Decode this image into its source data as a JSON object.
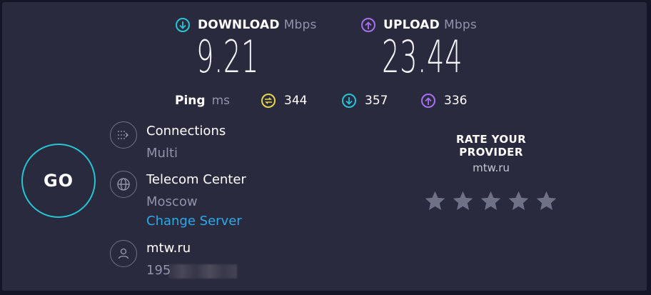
{
  "download": {
    "label": "DOWNLOAD",
    "unit": "Mbps",
    "value": "9.21",
    "icon": "download-arrow-icon",
    "color": "#26c5d3"
  },
  "upload": {
    "label": "UPLOAD",
    "unit": "Mbps",
    "value": "23.44",
    "icon": "upload-arrow-icon",
    "color": "#a770f0"
  },
  "ping": {
    "label": "Ping",
    "unit": "ms",
    "idle": {
      "value": "344",
      "icon": "latency-icon",
      "color": "#e8d648"
    },
    "download": {
      "value": "357",
      "icon": "download-arrow-icon",
      "color": "#26c5d3"
    },
    "upload": {
      "value": "336",
      "icon": "upload-arrow-icon",
      "color": "#a770f0"
    }
  },
  "go_button": {
    "label": "GO",
    "color": "#26c5d3"
  },
  "connections": {
    "title": "Connections",
    "value": "Multi",
    "icon": "connections-icon"
  },
  "server": {
    "title": "Telecom Center",
    "location": "Moscow",
    "change_label": "Change Server",
    "icon": "globe-icon"
  },
  "provider": {
    "name": "mtw.ru",
    "ip_prefix": "195",
    "icon": "user-icon"
  },
  "rating": {
    "title": "RATE YOUR PROVIDER",
    "isp": "mtw.ru",
    "max_stars": 5,
    "selected_stars": 0
  },
  "colors": {
    "background": "#141526",
    "panel": "#2a2a3e",
    "muted_text": "#9193a8",
    "link": "#2aa9e8",
    "star": "#6f7186"
  }
}
